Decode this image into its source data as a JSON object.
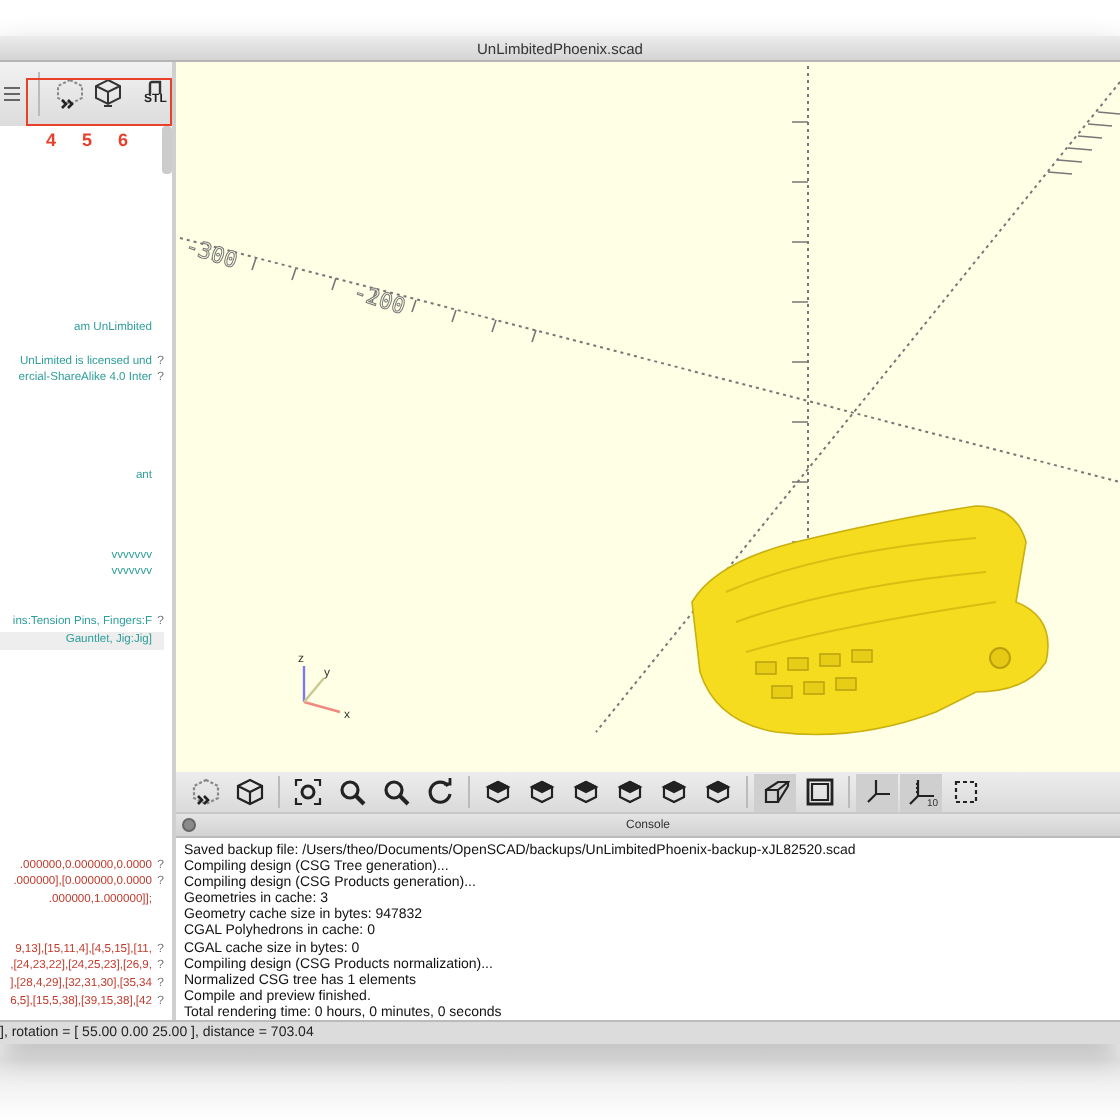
{
  "window": {
    "title": "UnLimbitedPhoenix.scad"
  },
  "editor_toolbar": {
    "buttons": [
      {
        "kind": "menu"
      },
      {
        "kind": "preview"
      },
      {
        "kind": "render"
      },
      {
        "kind": "stl"
      }
    ],
    "stl_label": "STL"
  },
  "callouts": [
    "4",
    "5",
    "6"
  ],
  "editor": {
    "blocks": [
      {
        "lines": [
          {
            "text": "am UnLimbited",
            "kind": "comment",
            "highlighted": false
          }
        ]
      },
      {
        "lines": [
          {
            "text": "UnLimited is licensed und",
            "kind": "comment",
            "highlighted": false,
            "marker": "?"
          },
          {
            "text": "ercial-ShareAlike 4.0 Inter",
            "kind": "comment",
            "highlighted": false,
            "marker": "?"
          }
        ]
      },
      {
        "lines": [
          {
            "text": "ant",
            "kind": "comment",
            "highlighted": false
          }
        ]
      },
      {
        "lines": [
          {
            "text": "vvvvvvv",
            "kind": "comment",
            "highlighted": false
          },
          {
            "text": "vvvvvvv",
            "kind": "comment",
            "highlighted": false
          }
        ]
      },
      {
        "lines": [
          {
            "text": "ins:Tension Pins, Fingers:F",
            "kind": "comment",
            "highlighted": false,
            "marker": "?"
          },
          {
            "text": "Gauntlet, Jig:Jig]",
            "kind": "comment",
            "highlighted": true
          }
        ]
      },
      {
        "lines": [
          {
            "text": ".000000,0.000000,0.0000",
            "kind": "data",
            "highlighted": false,
            "marker": "?"
          },
          {
            "text": ".000000],[0.000000,0.0000",
            "kind": "data",
            "highlighted": false,
            "marker": "?"
          },
          {
            "text": ".000000,1.000000]];",
            "kind": "data",
            "highlighted": false
          }
        ]
      },
      {
        "lines": [
          {
            "text": "9,13],[15,11,4],[4,5,15],[11,",
            "kind": "data",
            "highlighted": false,
            "marker": "?"
          },
          {
            "text": ",[24,23,22],[24,25,23],[26,9,",
            "kind": "data",
            "highlighted": false,
            "marker": "?"
          },
          {
            "text": "],[28,4,29],[32,31,30],[35,34",
            "kind": "data",
            "highlighted": false,
            "marker": "?"
          },
          {
            "text": "6,5],[15,5,38],[39,15,38],[42",
            "kind": "data",
            "highlighted": false,
            "marker": "?"
          }
        ]
      }
    ]
  },
  "viewport": {
    "tick_labels": [
      "-300",
      "-200"
    ],
    "axis_labels": [
      "z",
      "y",
      "x"
    ]
  },
  "viewport_toolbar": [
    {
      "kind": "preview",
      "selected": false
    },
    {
      "kind": "render",
      "selected": false
    },
    {
      "kind": "view-all",
      "selected": false
    },
    {
      "kind": "zoom-in",
      "selected": false
    },
    {
      "kind": "zoom-out",
      "selected": false
    },
    {
      "kind": "reset",
      "selected": false
    },
    {
      "kind": "view",
      "selected": false
    },
    {
      "kind": "view",
      "selected": false
    },
    {
      "kind": "view",
      "selected": false
    },
    {
      "kind": "view",
      "selected": false
    },
    {
      "kind": "view",
      "selected": false
    },
    {
      "kind": "view",
      "selected": false
    },
    {
      "kind": "perspective",
      "selected": true
    },
    {
      "kind": "orthogonal",
      "selected": false
    },
    {
      "kind": "axes",
      "selected": true
    },
    {
      "kind": "scale",
      "selected": true
    },
    {
      "kind": "edges",
      "selected": false
    }
  ],
  "scale_label": "10",
  "console": {
    "title": "Console",
    "lines": [
      "Saved backup file: /Users/theo/Documents/OpenSCAD/backups/UnLimbitedPhoenix-backup-xJL82520.scad",
      "Compiling design (CSG Tree generation)...",
      "Compiling design (CSG Products generation)...",
      "Geometries in cache: 3",
      "Geometry cache size in bytes: 947832",
      "CGAL Polyhedrons in cache: 0",
      "CGAL cache size in bytes: 0",
      "Compiling design (CSG Products normalization)...",
      "Normalized CSG tree has 1 elements",
      "Compile and preview finished.",
      "Total rendering time: 0 hours, 0 minutes, 0 seconds"
    ]
  },
  "status_bar": "], rotation = [ 55.00 0.00 25.00 ], distance = 703.04"
}
